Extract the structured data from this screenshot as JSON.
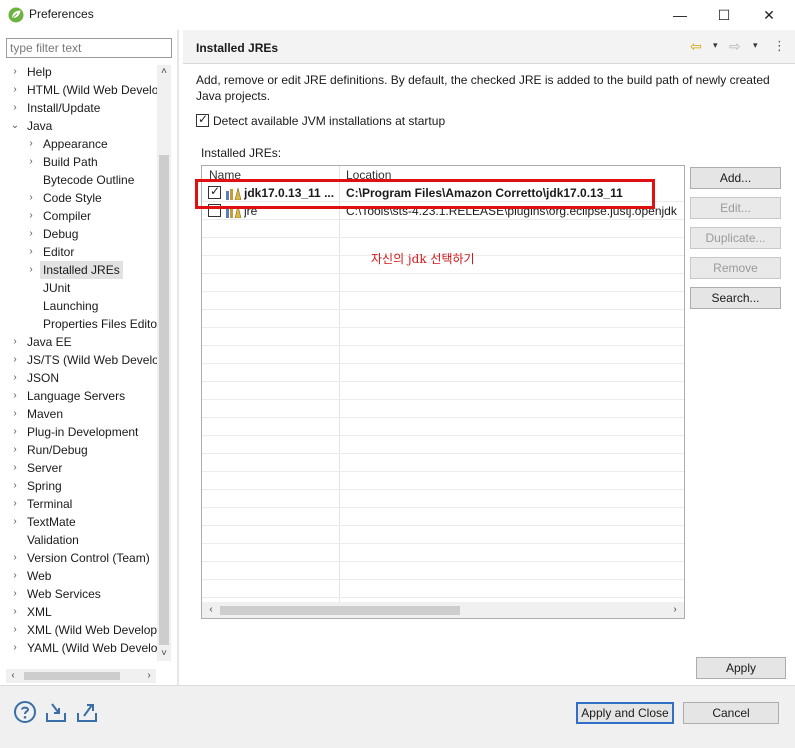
{
  "window": {
    "title": "Preferences",
    "minimize": "—",
    "maximize": "☐",
    "close": "✕"
  },
  "filter": {
    "placeholder": "type filter text"
  },
  "tree": {
    "items": [
      {
        "label": "Help",
        "depth": 0,
        "expander": "›",
        "selected": false
      },
      {
        "label": "HTML (Wild Web Develo",
        "depth": 0,
        "expander": "›",
        "selected": false
      },
      {
        "label": "Install/Update",
        "depth": 0,
        "expander": "›",
        "selected": false
      },
      {
        "label": "Java",
        "depth": 0,
        "expander": "⌄",
        "selected": false
      },
      {
        "label": "Appearance",
        "depth": 1,
        "expander": "›",
        "selected": false
      },
      {
        "label": "Build Path",
        "depth": 1,
        "expander": "›",
        "selected": false
      },
      {
        "label": "Bytecode Outline",
        "depth": 1,
        "expander": "",
        "selected": false
      },
      {
        "label": "Code Style",
        "depth": 1,
        "expander": "›",
        "selected": false
      },
      {
        "label": "Compiler",
        "depth": 1,
        "expander": "›",
        "selected": false
      },
      {
        "label": "Debug",
        "depth": 1,
        "expander": "›",
        "selected": false
      },
      {
        "label": "Editor",
        "depth": 1,
        "expander": "›",
        "selected": false
      },
      {
        "label": "Installed JREs",
        "depth": 1,
        "expander": "›",
        "selected": true
      },
      {
        "label": "JUnit",
        "depth": 1,
        "expander": "",
        "selected": false
      },
      {
        "label": "Launching",
        "depth": 1,
        "expander": "",
        "selected": false
      },
      {
        "label": "Properties Files Edito",
        "depth": 1,
        "expander": "",
        "selected": false
      },
      {
        "label": "Java EE",
        "depth": 0,
        "expander": "›",
        "selected": false
      },
      {
        "label": "JS/TS (Wild Web Develo",
        "depth": 0,
        "expander": "›",
        "selected": false
      },
      {
        "label": "JSON",
        "depth": 0,
        "expander": "›",
        "selected": false
      },
      {
        "label": "Language Servers",
        "depth": 0,
        "expander": "›",
        "selected": false
      },
      {
        "label": "Maven",
        "depth": 0,
        "expander": "›",
        "selected": false
      },
      {
        "label": "Plug-in Development",
        "depth": 0,
        "expander": "›",
        "selected": false
      },
      {
        "label": "Run/Debug",
        "depth": 0,
        "expander": "›",
        "selected": false
      },
      {
        "label": "Server",
        "depth": 0,
        "expander": "›",
        "selected": false
      },
      {
        "label": "Spring",
        "depth": 0,
        "expander": "›",
        "selected": false
      },
      {
        "label": "Terminal",
        "depth": 0,
        "expander": "›",
        "selected": false
      },
      {
        "label": "TextMate",
        "depth": 0,
        "expander": "›",
        "selected": false
      },
      {
        "label": "Validation",
        "depth": 0,
        "expander": "",
        "selected": false
      },
      {
        "label": "Version Control (Team)",
        "depth": 0,
        "expander": "›",
        "selected": false
      },
      {
        "label": "Web",
        "depth": 0,
        "expander": "›",
        "selected": false
      },
      {
        "label": "Web Services",
        "depth": 0,
        "expander": "›",
        "selected": false
      },
      {
        "label": "XML",
        "depth": 0,
        "expander": "›",
        "selected": false
      },
      {
        "label": "XML (Wild Web Develop",
        "depth": 0,
        "expander": "›",
        "selected": false
      },
      {
        "label": "YAML (Wild Web Develo",
        "depth": 0,
        "expander": "›",
        "selected": false
      }
    ]
  },
  "page": {
    "title": "Installed JREs",
    "description": "Add, remove or edit JRE definitions. By default, the checked JRE is added to the build path of newly created Java projects.",
    "detect_label": "Detect available JVM installations at startup",
    "detect_checked": true,
    "jres_label": "Installed JREs:",
    "columns": {
      "name": "Name",
      "location": "Location"
    },
    "rows": [
      {
        "name": "jdk17.0.13_11 ...",
        "location": "C:\\Program Files\\Amazon Corretto\\jdk17.0.13_11",
        "checked": true,
        "default": true
      },
      {
        "name": "jre",
        "location": "C:\\Tools\\sts-4.23.1.RELEASE\\plugins\\org.eclipse.justj.openjdk",
        "checked": false,
        "default": false
      }
    ],
    "annotation": "자신의 jdk 선택하기"
  },
  "buttons": {
    "add": "Add...",
    "edit": "Edit...",
    "duplicate": "Duplicate...",
    "remove": "Remove",
    "search": "Search...",
    "apply": "Apply",
    "apply_close": "Apply and Close",
    "cancel": "Cancel"
  },
  "icons": {
    "back": "⇦",
    "forward": "⇨",
    "dropdown": "▾",
    "menu": "⋮",
    "check": "✓",
    "scroll_up": "˄",
    "scroll_down": "˅",
    "scroll_left": "‹",
    "scroll_right": "›"
  },
  "colors": {
    "annotation_red": "#e01010",
    "primary_button_border": "#2f6fc8",
    "selected_tree_bg": "#e2e2e2"
  }
}
